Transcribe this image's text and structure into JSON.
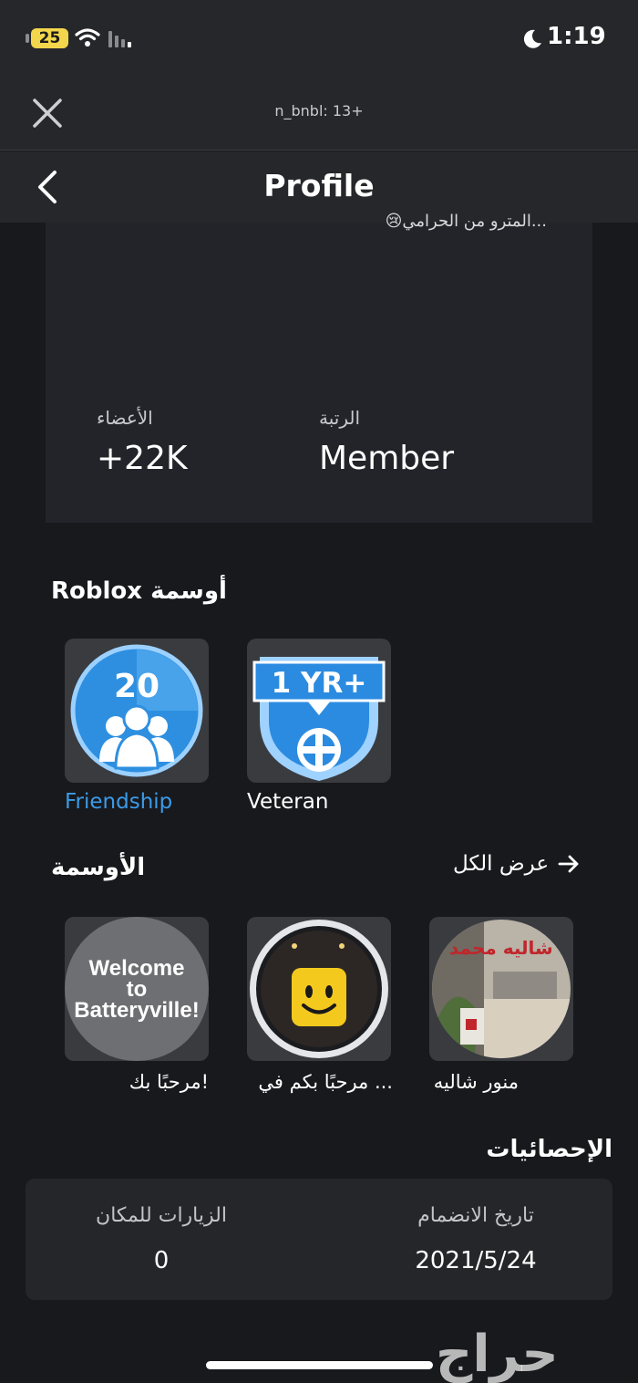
{
  "status_bar": {
    "battery": "25",
    "time": "1:19"
  },
  "browser": {
    "domain_text": "n_bnbl: 13+"
  },
  "nav": {
    "title": "Profile"
  },
  "group": {
    "description": "...المترو من الحرامي😢",
    "members_label": "الأعضاء",
    "members_value": "+22K",
    "rank_label": "الرتبة",
    "rank_value": "Member"
  },
  "roblox_badges": {
    "title": "Roblox أوسمة",
    "items": [
      {
        "name": "Friendship",
        "number": "20",
        "name_color": "#3b9be8"
      },
      {
        "name": "Veteran",
        "banner": "1 YR+",
        "name_color": "#ffffff"
      }
    ]
  },
  "badges": {
    "title": "الأوسمة",
    "view_all": "عرض الكل",
    "items": [
      {
        "name": "!مرحبًا بك",
        "image_text_lines": [
          "Welcome",
          "to",
          "Batteryville!"
        ]
      },
      {
        "name": "... مرحبًا بكم في"
      },
      {
        "name": "منور شاليه",
        "image_text": "شاليه محمد"
      }
    ]
  },
  "stats": {
    "title": "الإحصائيات",
    "join_date_label": "تاريخ الانضمام",
    "join_date_value": "2021/5/24",
    "visits_label": "الزيارات للمكان",
    "visits_value": "0"
  },
  "watermark": "حراج",
  "colors": {
    "background": "#18191d",
    "header": "#26272b",
    "card": "#232429",
    "accent_blue": "#3b9be8"
  }
}
